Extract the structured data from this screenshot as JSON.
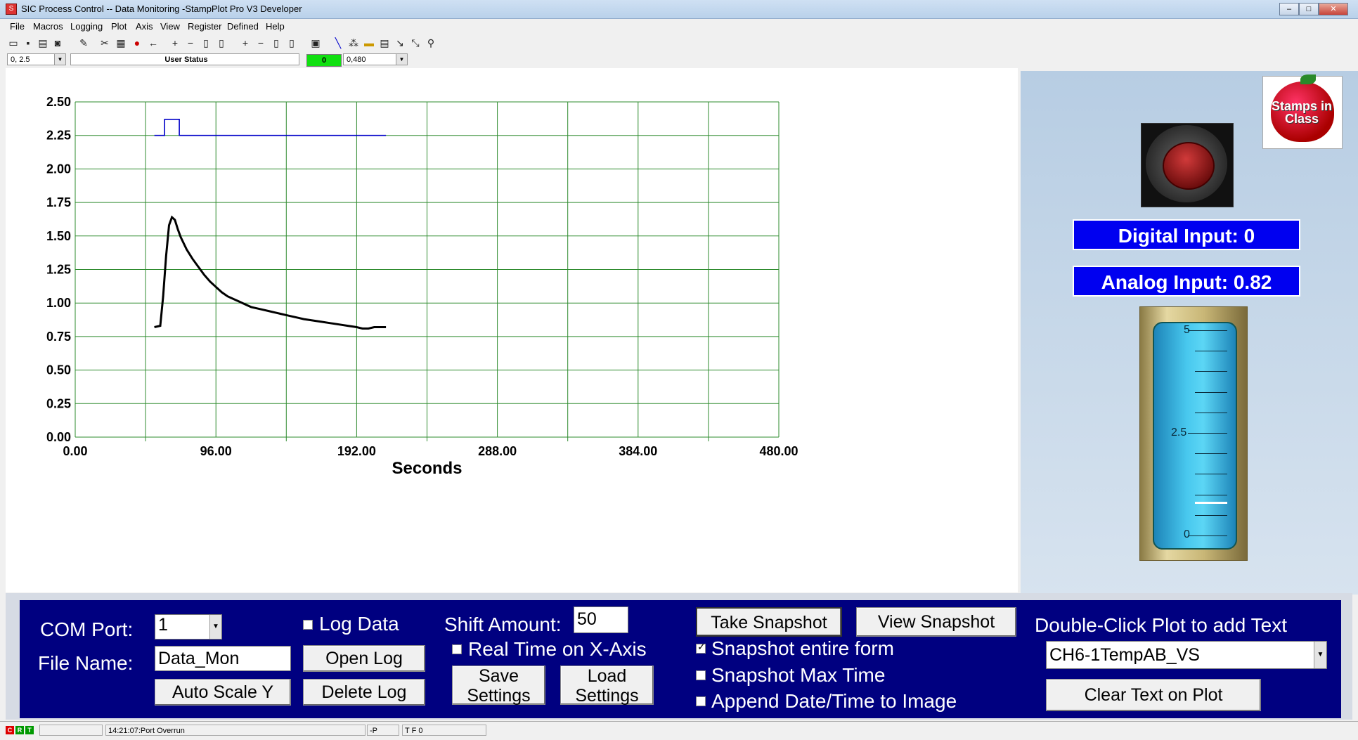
{
  "window": {
    "title": "SIC Process Control -- Data Monitoring  -StampPlot Pro V3 Developer"
  },
  "menu": [
    "File",
    "Macros",
    "Logging",
    "Plot",
    "Axis",
    "View",
    "Register",
    "Defined",
    "Help"
  ],
  "toolbar_icons": [
    "open-icon",
    "save-icon",
    "print-icon",
    "camera-icon",
    "pen-icon",
    "stamp-icon",
    "grid-icon",
    "stop-icon",
    "arrow-left-icon",
    "zoom-in-x-icon",
    "zoom-out-x-icon",
    "pan-x-icon",
    "reset-x-icon",
    "zoom-in-y-icon",
    "zoom-out-y-icon",
    "pan-y-icon",
    "reset-y-icon",
    "cursor-icon",
    "draw-icon",
    "marker-icon",
    "note-icon",
    "table-icon",
    "arrow-icon",
    "expand-icon",
    "probe-icon"
  ],
  "status_row": {
    "coord_combo": "0, 2.5",
    "user_status": "User Status",
    "indicator_value": "0",
    "time_combo": "0,480"
  },
  "chart_data": {
    "type": "line",
    "xlabel": "Seconds",
    "xlim": [
      0,
      480
    ],
    "ylim": [
      0,
      2.5
    ],
    "x_ticks": [
      "0.00",
      "96.00",
      "192.00",
      "288.00",
      "384.00",
      "480.00"
    ],
    "y_ticks": [
      "0.00",
      "0.25",
      "0.50",
      "0.75",
      "1.00",
      "1.25",
      "1.50",
      "1.75",
      "2.00",
      "2.25",
      "2.50"
    ],
    "grid": true,
    "colors": {
      "grid": "#2e8b2e",
      "digital": "#0000c8",
      "analog": "#000000"
    },
    "series": [
      {
        "color": "#0000c8",
        "points": [
          [
            54,
            2.25
          ],
          [
            61,
            2.25
          ],
          [
            61,
            2.37
          ],
          [
            71,
            2.37
          ],
          [
            71,
            2.25
          ],
          [
            212,
            2.25
          ]
        ]
      },
      {
        "color": "#000000",
        "points": [
          [
            54,
            0.82
          ],
          [
            58,
            0.83
          ],
          [
            60,
            1.05
          ],
          [
            62,
            1.35
          ],
          [
            64,
            1.58
          ],
          [
            66,
            1.64
          ],
          [
            68,
            1.62
          ],
          [
            70,
            1.55
          ],
          [
            72,
            1.49
          ],
          [
            76,
            1.4
          ],
          [
            80,
            1.33
          ],
          [
            84,
            1.27
          ],
          [
            88,
            1.21
          ],
          [
            92,
            1.16
          ],
          [
            96,
            1.12
          ],
          [
            100,
            1.08
          ],
          [
            104,
            1.05
          ],
          [
            108,
            1.03
          ],
          [
            112,
            1.01
          ],
          [
            116,
            0.99
          ],
          [
            120,
            0.97
          ],
          [
            124,
            0.96
          ],
          [
            128,
            0.95
          ],
          [
            132,
            0.94
          ],
          [
            136,
            0.93
          ],
          [
            140,
            0.92
          ],
          [
            144,
            0.91
          ],
          [
            148,
            0.9
          ],
          [
            152,
            0.89
          ],
          [
            156,
            0.88
          ],
          [
            162,
            0.87
          ],
          [
            168,
            0.86
          ],
          [
            174,
            0.85
          ],
          [
            180,
            0.84
          ],
          [
            186,
            0.83
          ],
          [
            192,
            0.82
          ],
          [
            196,
            0.81
          ],
          [
            200,
            0.81
          ],
          [
            204,
            0.82
          ],
          [
            212,
            0.82
          ]
        ]
      }
    ]
  },
  "right_panel": {
    "digital_input": "Digital Input: 0",
    "analog_input": "Analog Input: 0.82",
    "tank": {
      "max_label": "5",
      "mid_label": "2.5",
      "min_label": "0",
      "level_fraction": 0.164
    },
    "logo_text": "Stamps in Class",
    "colors": {
      "readout_bg": "#0000f0"
    }
  },
  "controls": {
    "com_port_label": "COM Port:",
    "com_port_value": "1",
    "file_name_label": "File Name:",
    "file_name_value": "Data_Mon",
    "auto_scale_label": "Auto Scale Y",
    "log_data_label": "Log Data",
    "open_log_label": "Open Log",
    "delete_log_label": "Delete Log",
    "shift_amount_label": "Shift Amount:",
    "shift_amount_value": "50",
    "real_time_label": "Real Time on X-Axis",
    "save_settings_label": "Save Settings",
    "load_settings_label": "Load Settings",
    "take_snapshot_label": "Take Snapshot",
    "view_snapshot_label": "View Snapshot",
    "snapshot_form_label": "Snapshot entire form",
    "snapshot_max_label": "Snapshot Max Time",
    "append_date_label": "Append Date/Time to Image",
    "double_click_label": "Double-Click Plot to add Text",
    "plot_text_value": "CH6-1TempAB_VS",
    "clear_text_label": "Clear Text on Plot",
    "checks": {
      "log_data": false,
      "real_time": false,
      "snapshot_form": true,
      "snapshot_max": false,
      "append_date": false
    },
    "colors": {
      "panel_bg": "#000080"
    }
  },
  "statusbar": {
    "leds": [
      "C",
      "R",
      "T"
    ],
    "message": "14:21:07:Port Overrun",
    "cell_p": "-P",
    "cell_tf": "T F 0"
  }
}
